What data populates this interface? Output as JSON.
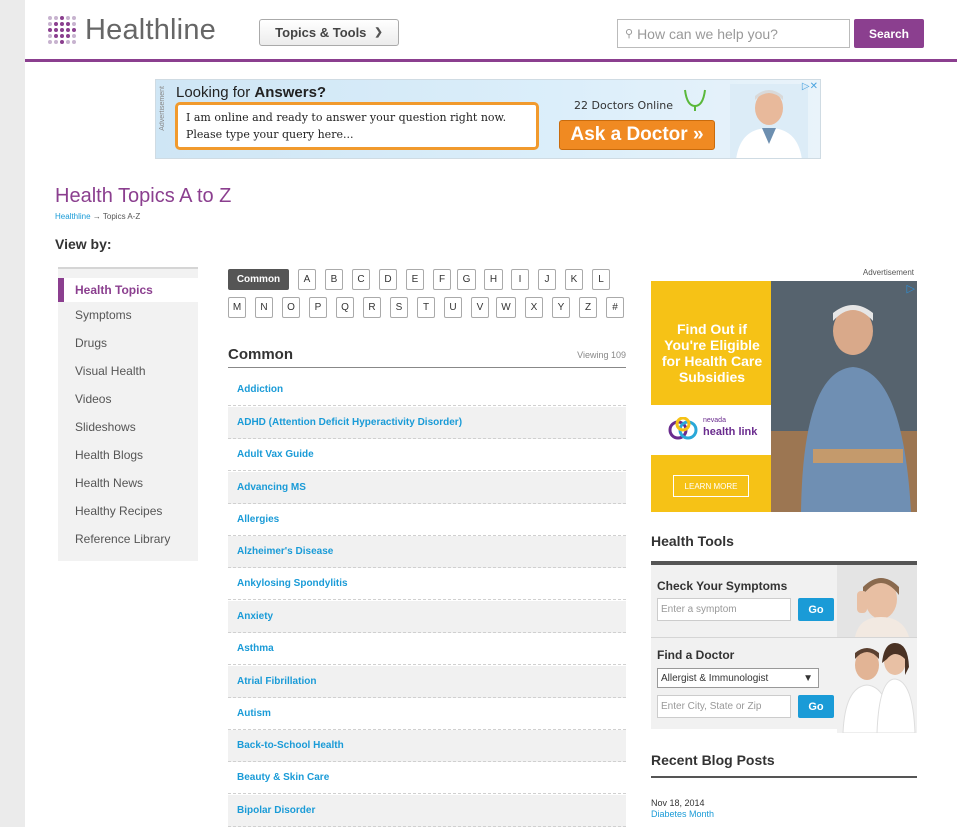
{
  "header": {
    "logo_text": "Healthline",
    "topics_button": "Topics & Tools",
    "search_placeholder": "How can we help you?",
    "search_button": "Search"
  },
  "top_ad": {
    "advertisement_tag": "Advertisement",
    "title_prefix": "Looking for ",
    "title_bold": "Answers?",
    "message_line1": "I am online and ready to answer your question right now.",
    "message_line2": "Please type your query here...",
    "online_count": "22 Doctors Online",
    "cta": "Ask a Doctor »"
  },
  "page": {
    "title": "Health Topics A to Z",
    "breadcrumb_home": "Healthline",
    "breadcrumb_arrow": "→",
    "breadcrumb_current": "Topics A-Z",
    "view_by": "View by:"
  },
  "sidebar": {
    "items": [
      {
        "label": "Health Topics",
        "active": true
      },
      {
        "label": "Symptoms"
      },
      {
        "label": "Drugs"
      },
      {
        "label": "Visual Health"
      },
      {
        "label": "Videos"
      },
      {
        "label": "Slideshows"
      },
      {
        "label": "Health Blogs"
      },
      {
        "label": "Health News"
      },
      {
        "label": "Healthy Recipes"
      },
      {
        "label": "Reference Library"
      }
    ]
  },
  "letters": {
    "row1": [
      "Common",
      "A",
      "B",
      "C",
      "D",
      "E",
      "F",
      "G",
      "H",
      "I",
      "J",
      "K",
      "L"
    ],
    "row2": [
      "M",
      "N",
      "O",
      "P",
      "Q",
      "R",
      "S",
      "T",
      "U",
      "V",
      "W",
      "X",
      "Y",
      "Z",
      "#"
    ]
  },
  "list": {
    "heading": "Common",
    "viewing": "Viewing 109",
    "topics": [
      "Addiction",
      "ADHD (Attention Deficit Hyperactivity Disorder)",
      "Adult Vax Guide",
      "Advancing MS",
      "Allergies",
      "Alzheimer's Disease",
      "Ankylosing Spondylitis",
      "Anxiety",
      "Asthma",
      "Atrial Fibrillation",
      "Autism",
      "Back-to-School Health",
      "Beauty & Skin Care",
      "Bipolar Disorder"
    ]
  },
  "right_ad": {
    "advertisement_tag": "Advertisement",
    "headline": "Find Out if You're Eligible for Health Care Subsidies",
    "brand_small": "nevada",
    "brand": "health link",
    "cta": "LEARN MORE"
  },
  "health_tools": {
    "title": "Health Tools",
    "symptoms_label": "Check Your Symptoms",
    "symptom_placeholder": "Enter a symptom",
    "go": "Go",
    "doctor_label": "Find a Doctor",
    "specialty_selected": "Allergist & Immunologist",
    "location_placeholder": "Enter City, State or Zip"
  },
  "blog": {
    "title": "Recent Blog Posts",
    "date": "Nov 18, 2014",
    "link": "Diabetes Month"
  },
  "colors": {
    "brand_purple": "#8b3f8f",
    "link_blue": "#1a9bd7",
    "ad_orange": "#f08a22",
    "ad_yellow": "#f6c216"
  }
}
